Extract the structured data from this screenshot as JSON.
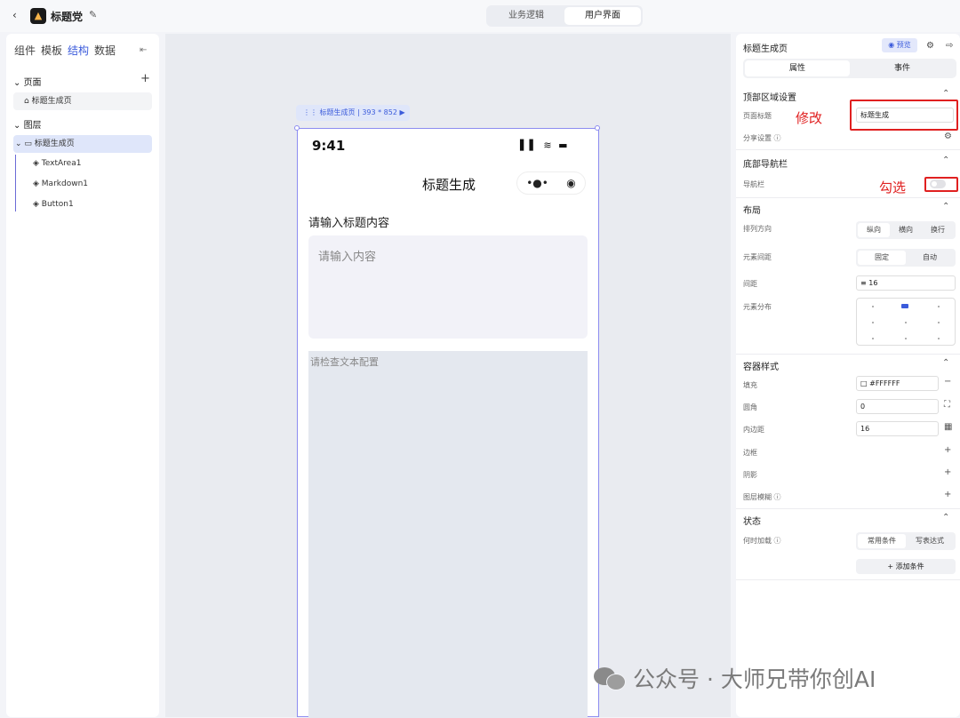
{
  "topbar": {
    "back_icon": "chevron-left",
    "app_name": "标题党",
    "modes": [
      "业务逻辑",
      "用户界面"
    ],
    "active_mode": "用户界面"
  },
  "left": {
    "tabs": [
      "组件",
      "模板",
      "结构",
      "数据"
    ],
    "active_tab": "结构",
    "pages_header": "页面",
    "pages": [
      "标题生成页"
    ],
    "layers_header": "图层",
    "layer_root": "标题生成页",
    "layer_children": [
      "TextArea1",
      "Markdown1",
      "Button1"
    ]
  },
  "canvas": {
    "frame_label": "标题生成页 | 393 * 852",
    "status_time": "9:41",
    "nav_title": "标题生成",
    "field_label": "请输入标题内容",
    "textarea_placeholder": "请输入内容",
    "markdown_text": "请检查文本配置"
  },
  "right": {
    "title": "标题生成页",
    "preview": "预览",
    "tabs": [
      "属性",
      "事件"
    ],
    "active_tab": "属性",
    "top_section": "顶部区域设置",
    "page_title_label": "页面标题",
    "page_title_value": "标题生成",
    "share_label": "分享设置",
    "bottom_nav_section": "底部导航栏",
    "nav_label": "导航栏",
    "nav_enabled": false,
    "layout_section": "布局",
    "direction_label": "排列方向",
    "direction_options": [
      "纵向",
      "横向",
      "换行"
    ],
    "direction_value": "纵向",
    "gap_mode_label": "元素间距",
    "gap_mode_options": [
      "固定",
      "自动"
    ],
    "gap_mode_value": "固定",
    "gap_label": "间距",
    "gap_value": "16",
    "distribution_label": "元素分布",
    "style_section": "容器样式",
    "fill_label": "填充",
    "fill_value": "#FFFFFF",
    "radius_label": "圆角",
    "radius_value": "0",
    "padding_label": "内边距",
    "padding_value": "16",
    "border_label": "边框",
    "shadow_label": "阴影",
    "blur_label": "图层模糊",
    "state_section": "状态",
    "load_label": "何时加载",
    "load_options": [
      "常用条件",
      "写表达式"
    ],
    "load_value": "常用条件",
    "add_condition": "+ 添加条件"
  },
  "annotations": {
    "modify": "修改",
    "check": "勾选"
  },
  "watermark": "公众号 · 大师兄带你创AI",
  "colors": {
    "accent": "#3b5bdb",
    "annotation": "#e02020",
    "frame": "#8c8cf0"
  }
}
